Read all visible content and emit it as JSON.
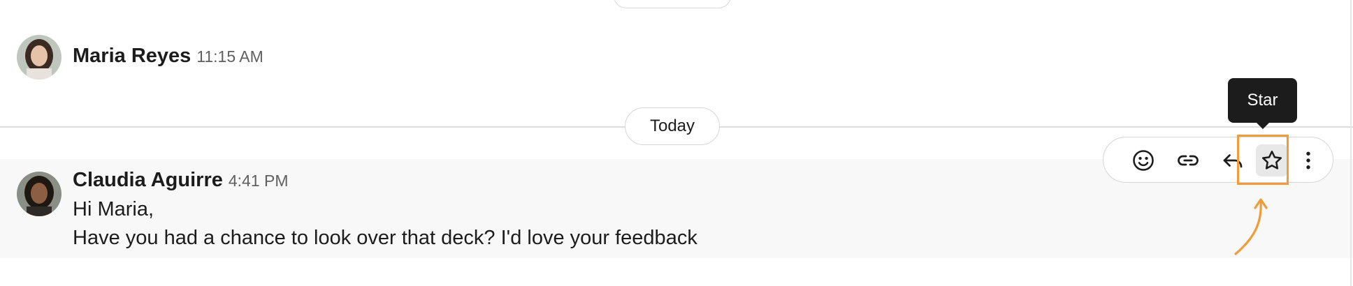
{
  "messages": [
    {
      "author": "Maria Reyes",
      "time": "11:15 AM",
      "lines": []
    },
    {
      "author": "Claudia Aguirre",
      "time": "4:41 PM",
      "lines": [
        "Hi Maria,",
        "Have you had a chance to look over that deck? I'd love your feedback"
      ]
    }
  ],
  "divider": {
    "label": "Today"
  },
  "actions": {
    "buttons": [
      "smile-icon",
      "link-icon",
      "reply-icon",
      "star-icon",
      "more-vertical-icon"
    ],
    "tooltip": "Star",
    "highlighted": "star-icon"
  },
  "colors": {
    "highlight_row": "#f8f8f8",
    "annotation": "#f19c38",
    "tooltip_bg": "#1d1c1d"
  }
}
